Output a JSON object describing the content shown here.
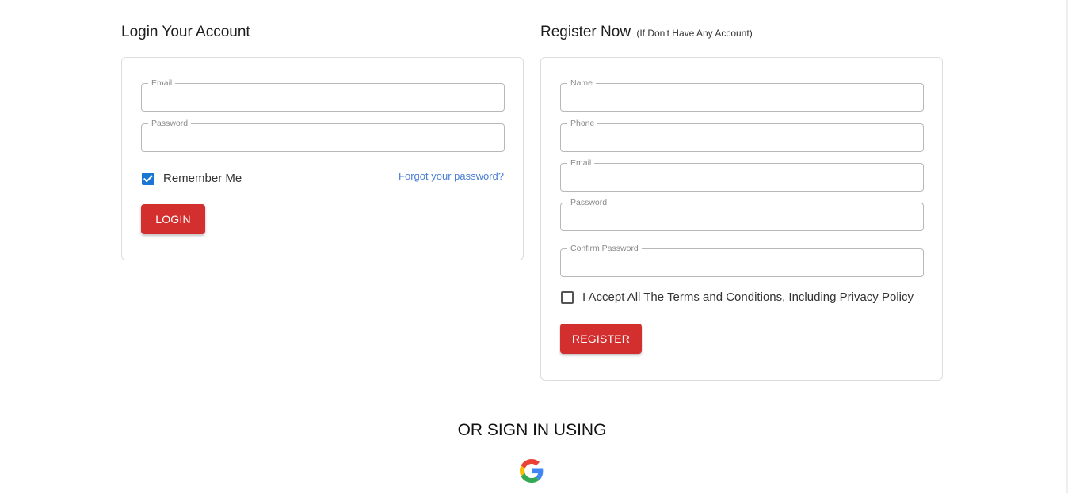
{
  "login": {
    "heading": "Login Your Account",
    "fields": {
      "email_label": "Email",
      "email_value": "",
      "password_label": "Password",
      "password_value": ""
    },
    "remember_label": "Remember Me",
    "remember_checked": true,
    "forgot_link": "Forgot your password?",
    "submit_label": "LOGIN"
  },
  "register": {
    "heading": "Register Now",
    "subheading": "(If Don't Have Any Account)",
    "fields": {
      "name_label": "Name",
      "phone_label": "Phone",
      "email_label": "Email",
      "password_label": "Password",
      "confirm_label": "Confirm Password"
    },
    "terms_label": "I Accept All The Terms and Conditions, Including Privacy Policy",
    "terms_checked": false,
    "submit_label": "REGISTER"
  },
  "social": {
    "title": "OR SIGN IN USING",
    "providers": [
      {
        "icon": "google-icon"
      }
    ]
  },
  "colors": {
    "button": "#d32f2f",
    "checkbox": "#1976d2",
    "link": "#4a7fd6"
  }
}
